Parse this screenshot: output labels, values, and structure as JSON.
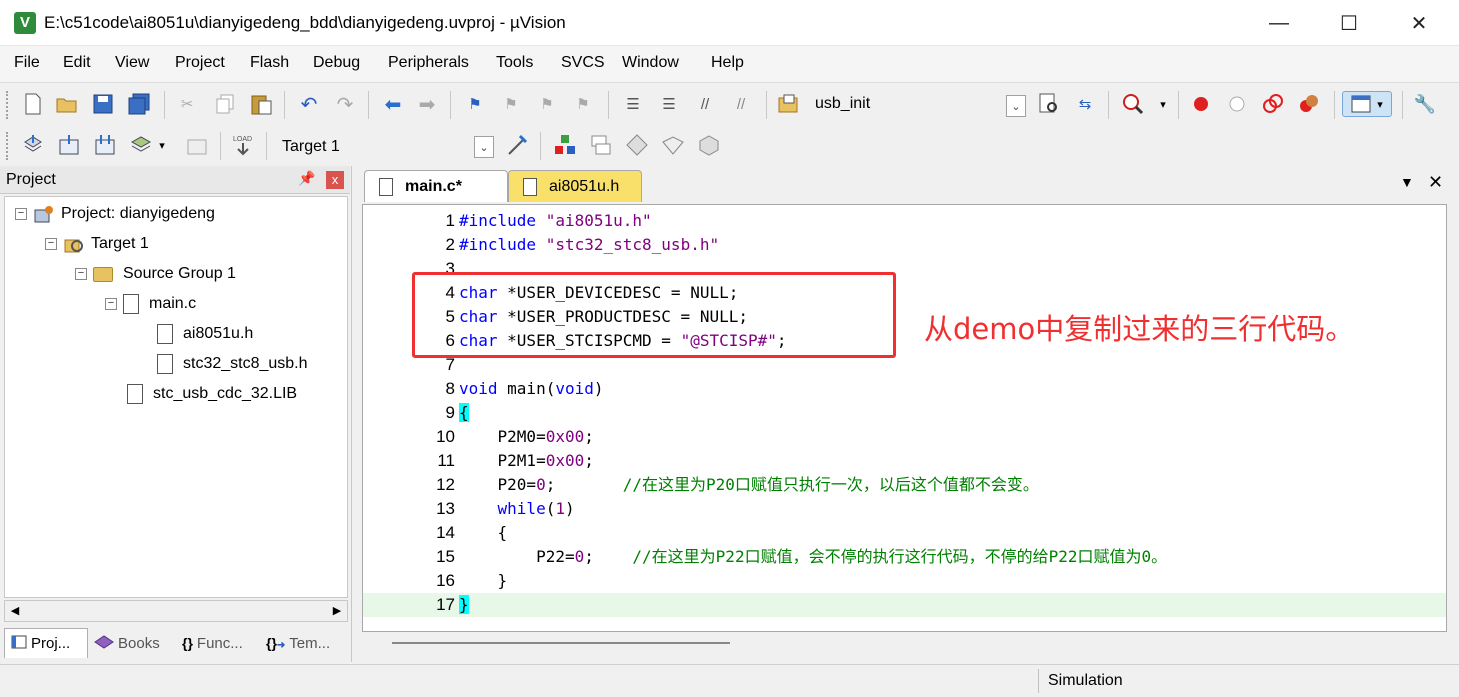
{
  "window": {
    "title": "E:\\c51code\\ai8051u\\dianyigedeng_bdd\\dianyigedeng.uvproj - µVision",
    "app_icon": "V",
    "minimize": "—",
    "maximize": "☐",
    "close": "✕"
  },
  "menu": {
    "items": [
      "File",
      "Edit",
      "View",
      "Project",
      "Flash",
      "Debug",
      "Peripherals",
      "Tools",
      "SVCS",
      "Window",
      "Help"
    ]
  },
  "toolbar": {
    "function_combo": "usb_init",
    "target_combo": "Target 1"
  },
  "project_panel": {
    "title": "Project",
    "pin": "ᵖ",
    "close": "x",
    "tree": [
      {
        "label": "Project: dianyigedeng",
        "icon": "project-icon"
      },
      {
        "label": "Target 1",
        "icon": "target-icon"
      },
      {
        "label": "Source Group 1",
        "icon": "folder-icon"
      },
      {
        "label": "main.c",
        "icon": "file-icon"
      },
      {
        "label": "ai8051u.h",
        "icon": "file-icon"
      },
      {
        "label": "stc32_stc8_usb.h",
        "icon": "file-icon"
      },
      {
        "label": "stc_usb_cdc_32.LIB",
        "icon": "file-icon"
      }
    ],
    "tabs": [
      {
        "label": "Proj...",
        "icon": "project-window-icon"
      },
      {
        "label": "Books",
        "icon": "books-icon"
      },
      {
        "label": "Func...",
        "icon": "functions-icon"
      },
      {
        "label": "Tem...",
        "icon": "templates-icon"
      }
    ]
  },
  "editor": {
    "tabs": [
      {
        "label": "main.c*",
        "active": true
      },
      {
        "label": "ai8051u.h",
        "active": false
      }
    ],
    "lines": [
      {
        "n": "1",
        "text": "#include \"ai8051u.h\""
      },
      {
        "n": "2",
        "text": "#include \"stc32_stc8_usb.h\""
      },
      {
        "n": "3",
        "text": ""
      },
      {
        "n": "4",
        "text": "char *USER_DEVICEDESC = NULL;"
      },
      {
        "n": "5",
        "text": "char *USER_PRODUCTDESC = NULL;"
      },
      {
        "n": "6",
        "text": "char *USER_STCISPCMD = \"@STCISP#\";"
      },
      {
        "n": "7",
        "text": ""
      },
      {
        "n": "8",
        "text": "void main(void)"
      },
      {
        "n": "9",
        "text": "{"
      },
      {
        "n": "10",
        "text": "    P2M0=0x00;"
      },
      {
        "n": "11",
        "text": "    P2M1=0x00;"
      },
      {
        "n": "12",
        "text": "    P20=0;       //在这里为P20口赋值只执行一次，以后这个值都不会变。"
      },
      {
        "n": "13",
        "text": "    while(1)"
      },
      {
        "n": "14",
        "text": "    {"
      },
      {
        "n": "15",
        "text": "        P22=0;    //在这里为P22口赋值，会不停的执行这行代码，不停的给P22口赋值为0。"
      },
      {
        "n": "16",
        "text": "    }"
      },
      {
        "n": "17",
        "text": "}"
      }
    ],
    "annotation": "从demo中复制过来的三行代码。",
    "highlight_color": "#f03030"
  },
  "status": {
    "mode": "Simulation"
  },
  "colors": {
    "keyword": "#0000ff",
    "string": "#800080",
    "comment": "#008000",
    "brace_highlight": "#00ffff",
    "active_tab": "#ffffff",
    "inactive_tab": "#f8e06a"
  }
}
